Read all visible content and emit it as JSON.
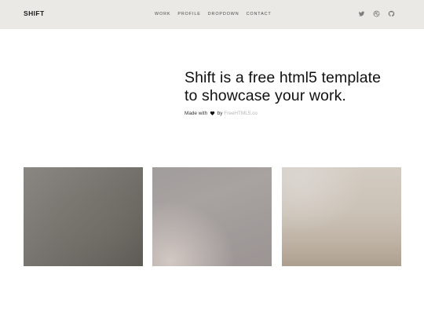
{
  "header": {
    "brand": "SHIFT",
    "nav": [
      {
        "label": "WORK"
      },
      {
        "label": "PROFILE"
      },
      {
        "label": "DROPDOWN"
      },
      {
        "label": "CONTACT"
      }
    ],
    "social": [
      {
        "icon": "twitter-icon"
      },
      {
        "icon": "dribbble-icon"
      },
      {
        "icon": "github-icon"
      }
    ]
  },
  "hero": {
    "headline_line1": "Shift is a free html5 template",
    "headline_line2": "to showcase your work.",
    "credit_prefix": "Made with",
    "credit_heart_icon": "heart-icon",
    "credit_by": "by",
    "credit_link": "FreeHTML5.co"
  },
  "gallery": {
    "items": [
      {
        "name": "work-thumbnail-1"
      },
      {
        "name": "work-thumbnail-2"
      },
      {
        "name": "work-thumbnail-3"
      }
    ]
  },
  "colors": {
    "header_bg": "#ebe9e5",
    "text": "#111111",
    "muted_link": "#b5b5b5"
  }
}
